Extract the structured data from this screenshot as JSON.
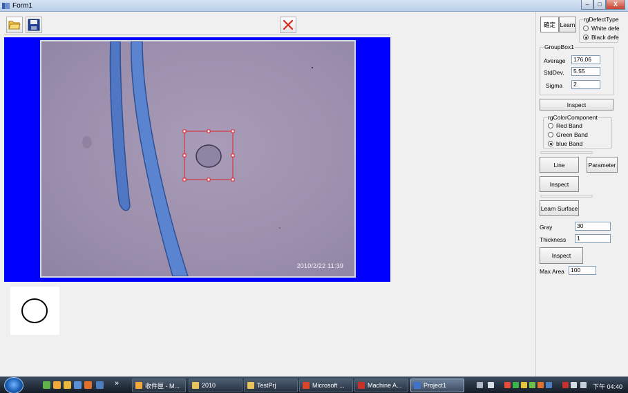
{
  "window": {
    "title": "Form1",
    "minimize": "–",
    "maximize": "□",
    "close": "X"
  },
  "image": {
    "timestamp": "2010/2/22 11:39"
  },
  "right_panel": {
    "tab_confirm": "確定",
    "tab_learn": "Learn",
    "defect_type": {
      "legend": "rgDefectType",
      "options": [
        "White defe",
        "Black defe"
      ],
      "selected": "Black defe"
    },
    "groupbox1": {
      "legend": "GroupBox1",
      "average_label": "Average",
      "average_value": "176.06",
      "stddev_label": "StdDev.",
      "stddev_value": "5.55",
      "sigma_label": "Sigma",
      "sigma_value": "2"
    },
    "inspect1": "Inspect",
    "color_component": {
      "legend": "rgColorComponent",
      "options": [
        "Red Band",
        "Green Band",
        "blue Band"
      ],
      "selected": "blue Band"
    },
    "line_button": "Line",
    "parameter_button": "Parameter",
    "inspect2": "Inspect",
    "learn_surface": "Learn Surface",
    "gray_label": "Gray",
    "gray_value": "30",
    "thickness_label": "Thickness",
    "thickness_value": "1",
    "inspect3": "Inspect",
    "max_area_label": "Max Area",
    "max_area_value": "100"
  },
  "taskbar": {
    "quicklaunch_overflow": "»",
    "tasks": [
      {
        "label": "收件匣 - M...",
        "color": "#f2a93b"
      },
      {
        "label": "2010",
        "color": "#e8c25a"
      },
      {
        "label": "TestPrj",
        "color": "#e8c25a"
      },
      {
        "label": "Microsoft ...",
        "color": "#d9452b"
      },
      {
        "label": "Machine A...",
        "color": "#c8302c"
      },
      {
        "label": "Project1",
        "color": "#3f72c9"
      }
    ],
    "clock": "下午 04:40"
  }
}
